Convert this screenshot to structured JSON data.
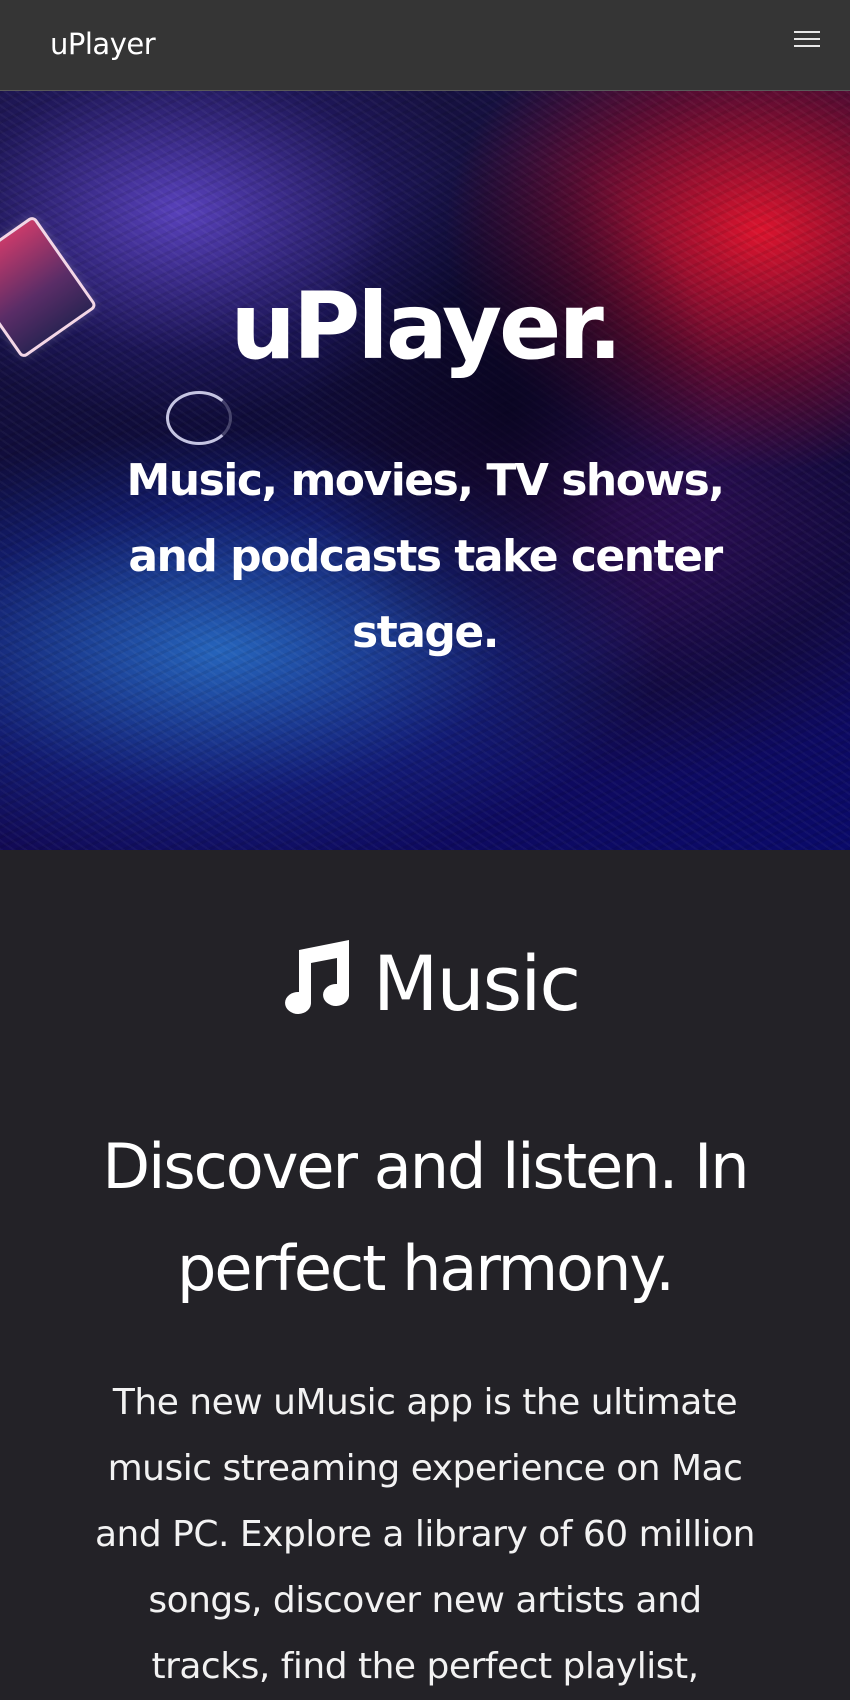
{
  "navbar": {
    "brand": "uPlayer",
    "menu_icon": "hamburger-menu-icon"
  },
  "hero": {
    "title": "uPlayer.",
    "subtitle": "Music, movies, TV shows, and podcasts take center stage."
  },
  "music_section": {
    "icon": "music-note-icon",
    "heading": "Music",
    "tagline": "Discover and listen. In perfect harmony.",
    "description": "The new uMusic app is the ultimate music streaming experience on Mac and PC. Explore a library of 60 million songs, discover new artists and tracks, find the perfect playlist,"
  },
  "colors": {
    "navbar_bg": "#353535",
    "section_bg": "#232227",
    "text": "#ffffff"
  }
}
